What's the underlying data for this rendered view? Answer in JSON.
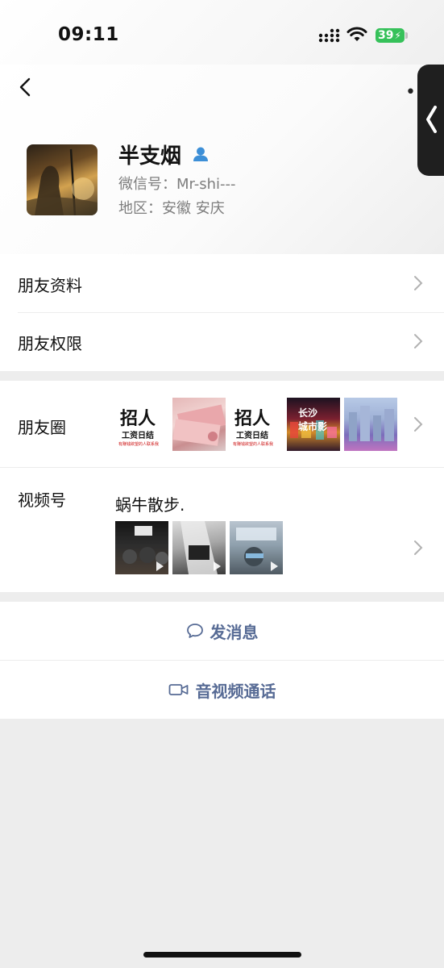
{
  "status_bar": {
    "time": "09:11",
    "battery": "39"
  },
  "profile": {
    "name": "半支烟",
    "wechat_id": "微信号：Mr-shi---",
    "region": "地区：安徽 安庆"
  },
  "menu": {
    "friend_info": "朋友资料",
    "friend_permissions": "朋友权限",
    "moments": "朋友圈",
    "channels": "视频号",
    "channel_name": "蜗牛散步."
  },
  "moments_thumbs": [
    {
      "big": "招人",
      "mid": "工资日结",
      "small": "有赚钱欲望的人联系我"
    },
    {
      "big": "招人",
      "mid": "工资日结",
      "small": "有赚钱欲望的人联系我"
    },
    {
      "txt": "长沙\n城市影"
    }
  ],
  "actions": {
    "message": "发消息",
    "call": "音视频通话"
  },
  "colors": {
    "link_blue": "#576b95",
    "battery_green": "#36c15a",
    "gender_blue": "#3d8fd7"
  }
}
